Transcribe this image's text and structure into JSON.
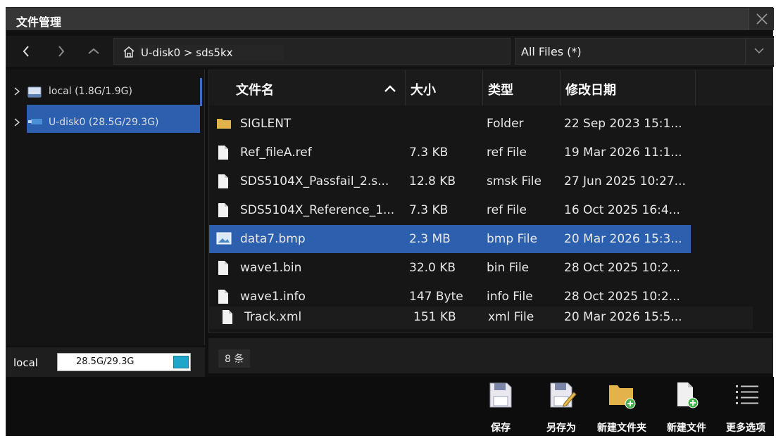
{
  "window": {
    "title": "文件管理"
  },
  "path": {
    "root": "U-disk0",
    "separator": ">",
    "folder": "sds5kx"
  },
  "filter": {
    "selected": "All Files (*)"
  },
  "tree": [
    {
      "label": "local  (1.8G/1.9G)",
      "selected": false
    },
    {
      "label": "U-disk0  (28.5G/29.3G)",
      "selected": true
    }
  ],
  "table": {
    "columns": [
      "文件名",
      "大小",
      "类型",
      "修改日期"
    ],
    "rows": [
      {
        "name": "SIGLENT",
        "size": "",
        "type": "Folder",
        "date": "22 Sep 2023 15:1...",
        "icon": "folder-icon"
      },
      {
        "name": "Ref_fileA.ref",
        "size": "7.3 KB",
        "type": "ref File",
        "date": "19 Mar 2026 11:1...",
        "icon": "file-icon"
      },
      {
        "name": "SDS5104X_Passfail_2.s...",
        "size": "12.8 KB",
        "type": "smsk File",
        "date": "27 Jun 2025 10:27...",
        "icon": "file-icon"
      },
      {
        "name": "SDS5104X_Reference_1...",
        "size": "7.3 KB",
        "type": "ref File",
        "date": "16 Oct 2025 16:4...",
        "icon": "file-icon"
      },
      {
        "name": "data7.bmp",
        "size": "2.3 MB",
        "type": "bmp File",
        "date": "20 Mar 2026 15:3...",
        "icon": "image-icon"
      },
      {
        "name": "wave1.bin",
        "size": "32.0 KB",
        "type": "bin File",
        "date": "28 Oct 2025 10:2...",
        "icon": "file-icon"
      },
      {
        "name": "wave1.info",
        "size": "147 Byte",
        "type": "info File",
        "date": "28 Oct 2025 10:2...",
        "icon": "file-icon"
      },
      {
        "name": "Track.xml",
        "size": "151 KB",
        "type": "xml  File",
        "date": "20 Mar 2026  15:5...",
        "icon": "file-icon"
      }
    ]
  },
  "status": {
    "storage_label": "local",
    "storage_text": "28.5G/29.3G",
    "count": "8 条"
  },
  "toolbar": {
    "save": "保存",
    "save_as": "另存为",
    "new_folder": "新建文件夹",
    "new_file": "新建文件",
    "more": "更多选项"
  },
  "colors": {
    "selection": "#2c5fae",
    "folder": "#e3b24a",
    "storage_fill": "#1fa6c8"
  }
}
